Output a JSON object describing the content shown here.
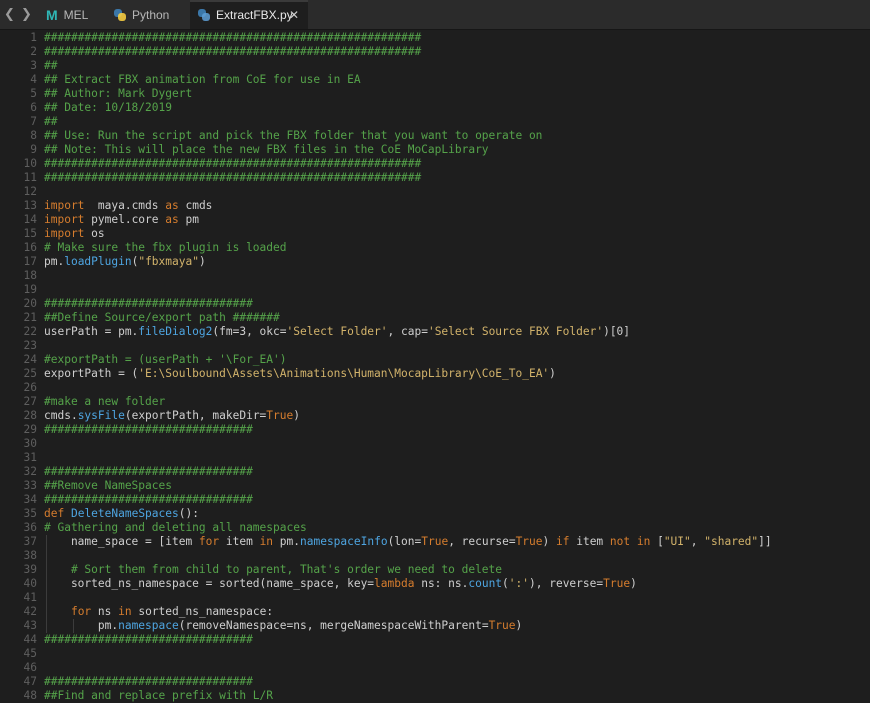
{
  "nav": {
    "back": "❮",
    "forward": "❯"
  },
  "tabs": [
    {
      "label": "MEL",
      "icon": "maya-icon"
    },
    {
      "label": "Python",
      "icon": "python-icon"
    },
    {
      "label": "ExtractFBX.py",
      "icon": "python-icon",
      "active": true,
      "close": "✕"
    }
  ],
  "code_lines": [
    {
      "n": "1",
      "segs": [
        [
          "cm",
          "########################################################"
        ]
      ]
    },
    {
      "n": "2",
      "segs": [
        [
          "cm",
          "########################################################"
        ]
      ]
    },
    {
      "n": "3",
      "segs": [
        [
          "cm",
          "##"
        ]
      ]
    },
    {
      "n": "4",
      "segs": [
        [
          "cm",
          "## Extract FBX animation from CoE for use in EA"
        ]
      ]
    },
    {
      "n": "5",
      "segs": [
        [
          "cm",
          "## Author: Mark Dygert"
        ]
      ]
    },
    {
      "n": "6",
      "segs": [
        [
          "cm",
          "## Date: 10/18/2019"
        ]
      ]
    },
    {
      "n": "7",
      "segs": [
        [
          "cm",
          "##"
        ]
      ]
    },
    {
      "n": "8",
      "segs": [
        [
          "cm",
          "## Use: Run the script and pick the FBX folder that you want to operate on"
        ]
      ]
    },
    {
      "n": "9",
      "segs": [
        [
          "cm",
          "## Note: This will place the new FBX files in the CoE MoCapLibrary"
        ]
      ]
    },
    {
      "n": "10",
      "segs": [
        [
          "cm",
          "########################################################"
        ]
      ]
    },
    {
      "n": "11",
      "segs": [
        [
          "cm",
          "########################################################"
        ]
      ]
    },
    {
      "n": "12",
      "segs": []
    },
    {
      "n": "13",
      "segs": [
        [
          "kw",
          "import"
        ],
        [
          "",
          "  maya.cmds "
        ],
        [
          "kw",
          "as"
        ],
        [
          "",
          " cmds"
        ]
      ]
    },
    {
      "n": "14",
      "segs": [
        [
          "kw",
          "import"
        ],
        [
          "",
          " pymel.core "
        ],
        [
          "kw",
          "as"
        ],
        [
          "",
          " pm"
        ]
      ]
    },
    {
      "n": "15",
      "segs": [
        [
          "kw",
          "import"
        ],
        [
          "",
          " os"
        ]
      ]
    },
    {
      "n": "16",
      "segs": [
        [
          "cm",
          "# Make sure the fbx plugin is loaded"
        ]
      ]
    },
    {
      "n": "17",
      "segs": [
        [
          "",
          "pm."
        ],
        [
          "fn",
          "loadPlugin"
        ],
        [
          "",
          "("
        ],
        [
          "st",
          "\"fbxmaya\""
        ],
        [
          "",
          ")"
        ]
      ]
    },
    {
      "n": "18",
      "segs": []
    },
    {
      "n": "19",
      "segs": []
    },
    {
      "n": "20",
      "segs": [
        [
          "cm",
          "###############################"
        ]
      ]
    },
    {
      "n": "21",
      "segs": [
        [
          "cm",
          "##Define Source/export path #######"
        ]
      ]
    },
    {
      "n": "22",
      "segs": [
        [
          "",
          "userPath = pm."
        ],
        [
          "fn",
          "fileDialog2"
        ],
        [
          "",
          "(fm=3, okc="
        ],
        [
          "st",
          "'Select Folder'"
        ],
        [
          "",
          ", cap="
        ],
        [
          "st",
          "'Select Source FBX Folder'"
        ],
        [
          "",
          ")[0]"
        ]
      ]
    },
    {
      "n": "23",
      "segs": []
    },
    {
      "n": "24",
      "segs": [
        [
          "cm",
          "#exportPath = (userPath + '\\For_EA')"
        ]
      ]
    },
    {
      "n": "25",
      "segs": [
        [
          "",
          "exportPath = ("
        ],
        [
          "st",
          "'E:\\Soulbound\\Assets\\Animations\\Human\\MocapLibrary\\CoE_To_EA'"
        ],
        [
          "",
          ")"
        ]
      ]
    },
    {
      "n": "26",
      "segs": []
    },
    {
      "n": "27",
      "segs": [
        [
          "cm",
          "#make a new folder"
        ]
      ]
    },
    {
      "n": "28",
      "segs": [
        [
          "",
          "cmds."
        ],
        [
          "fn",
          "sysFile"
        ],
        [
          "",
          "(exportPath, makeDir="
        ],
        [
          "bi",
          "True"
        ],
        [
          "",
          ")"
        ]
      ]
    },
    {
      "n": "29",
      "segs": [
        [
          "cm",
          "###############################"
        ]
      ]
    },
    {
      "n": "30",
      "segs": []
    },
    {
      "n": "31",
      "segs": []
    },
    {
      "n": "32",
      "segs": [
        [
          "cm",
          "###############################"
        ]
      ]
    },
    {
      "n": "33",
      "segs": [
        [
          "cm",
          "##Remove NameSpaces"
        ]
      ]
    },
    {
      "n": "34",
      "segs": [
        [
          "cm",
          "###############################"
        ]
      ]
    },
    {
      "n": "35",
      "segs": [
        [
          "kw",
          "def"
        ],
        [
          "",
          " "
        ],
        [
          "fn",
          "DeleteNameSpaces"
        ],
        [
          "",
          "():"
        ]
      ]
    },
    {
      "n": "36",
      "segs": [
        [
          "cm",
          "# Gathering and deleting all namespaces"
        ]
      ]
    },
    {
      "n": "37",
      "segs": [
        [
          "",
          "    name_space = [item "
        ],
        [
          "kw",
          "for"
        ],
        [
          "",
          " item "
        ],
        [
          "kw",
          "in"
        ],
        [
          "",
          " pm."
        ],
        [
          "fn",
          "namespaceInfo"
        ],
        [
          "",
          "(lon="
        ],
        [
          "bi",
          "True"
        ],
        [
          "",
          ", recurse="
        ],
        [
          "bi",
          "True"
        ],
        [
          "",
          ") "
        ],
        [
          "kw",
          "if"
        ],
        [
          "",
          " item "
        ],
        [
          "kw",
          "not in"
        ],
        [
          "",
          " ["
        ],
        [
          "st",
          "\"UI\""
        ],
        [
          "",
          ", "
        ],
        [
          "st",
          "\"shared\""
        ],
        [
          "",
          "]]"
        ]
      ]
    },
    {
      "n": "38",
      "segs": []
    },
    {
      "n": "39",
      "segs": [
        [
          "cm",
          "    # Sort them from child to parent, That's order we need to delete"
        ]
      ]
    },
    {
      "n": "40",
      "segs": [
        [
          "",
          "    sorted_ns_namespace = sorted(name_space, key="
        ],
        [
          "kw",
          "lambda"
        ],
        [
          "",
          " ns: ns."
        ],
        [
          "fn",
          "count"
        ],
        [
          "",
          "("
        ],
        [
          "st",
          "':'"
        ],
        [
          "",
          "), reverse="
        ],
        [
          "bi",
          "True"
        ],
        [
          "",
          ")"
        ]
      ]
    },
    {
      "n": "41",
      "segs": []
    },
    {
      "n": "42",
      "segs": [
        [
          "",
          "    "
        ],
        [
          "kw",
          "for"
        ],
        [
          "",
          " ns "
        ],
        [
          "kw",
          "in"
        ],
        [
          "",
          " sorted_ns_namespace:"
        ]
      ]
    },
    {
      "n": "43",
      "segs": [
        [
          "",
          "        pm."
        ],
        [
          "fn",
          "namespace"
        ],
        [
          "",
          "(removeNamespace=ns, mergeNamespaceWithParent="
        ],
        [
          "bi",
          "True"
        ],
        [
          "",
          ")"
        ]
      ]
    },
    {
      "n": "44",
      "segs": [
        [
          "cm",
          "###############################"
        ]
      ]
    },
    {
      "n": "45",
      "segs": []
    },
    {
      "n": "46",
      "segs": []
    },
    {
      "n": "47",
      "segs": [
        [
          "cm",
          "###############################"
        ]
      ]
    },
    {
      "n": "48",
      "segs": [
        [
          "cm",
          "##Find and replace prefix with L/R"
        ]
      ]
    }
  ]
}
